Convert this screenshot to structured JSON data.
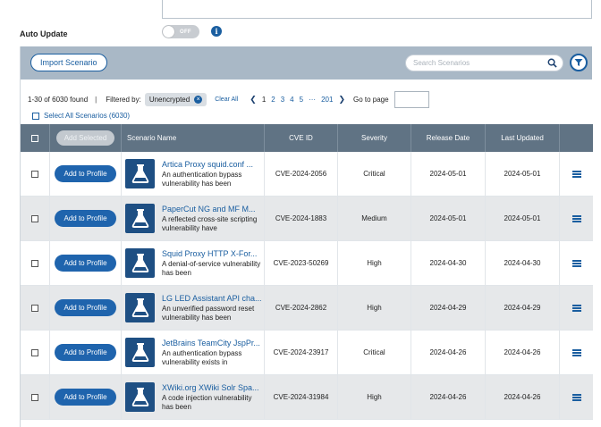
{
  "auto_update": {
    "label": "Auto Update",
    "toggle_text": "OFF",
    "info_glyph": "i"
  },
  "toolbar": {
    "import_label": "Import Scenario",
    "search_placeholder": "Search Scenarios"
  },
  "results": {
    "found_text": "1-30 of 6030 found",
    "separator": "|",
    "filtered_by": "Filtered by:",
    "filter_chip": "Unencrypted",
    "clear_all": "Clear All",
    "pages": [
      "1",
      "2",
      "3",
      "4",
      "5",
      "···",
      "201"
    ],
    "current_page": "1",
    "go_to_page": "Go to page",
    "select_all": "Select All Scenarios (6030)"
  },
  "table": {
    "add_selected": "Add Selected",
    "columns": [
      "Scenario Name",
      "CVE ID",
      "Severity",
      "Release Date",
      "Last Updated"
    ],
    "add_label": "Add to Profile",
    "rows": [
      {
        "title": "Artica Proxy squid.conf ...",
        "desc": "An authentication bypass vulnerability has been",
        "cve": "CVE-2024-2056",
        "severity": "Critical",
        "release": "2024-05-01",
        "updated": "2024-05-01"
      },
      {
        "title": "PaperCut NG and MF M...",
        "desc": "A reflected cross-site scripting vulnerability have",
        "cve": "CVE-2024-1883",
        "severity": "Medium",
        "release": "2024-05-01",
        "updated": "2024-05-01"
      },
      {
        "title": "Squid Proxy HTTP X-For...",
        "desc": "A denial-of-service vulnerability has been",
        "cve": "CVE-2023-50269",
        "severity": "High",
        "release": "2024-04-30",
        "updated": "2024-04-30"
      },
      {
        "title": "LG LED Assistant API cha...",
        "desc": "An unverified password reset vulnerability has been",
        "cve": "CVE-2024-2862",
        "severity": "High",
        "release": "2024-04-29",
        "updated": "2024-04-29"
      },
      {
        "title": "JetBrains TeamCity JspPr...",
        "desc": "An authentication bypass vulnerability exists in",
        "cve": "CVE-2024-23917",
        "severity": "Critical",
        "release": "2024-04-26",
        "updated": "2024-04-26"
      },
      {
        "title": "XWiki.org XWiki Solr Spa...",
        "desc": "A code injection vulnerability has been",
        "cve": "CVE-2024-31984",
        "severity": "High",
        "release": "2024-04-26",
        "updated": "2024-04-26"
      }
    ]
  },
  "colors": {
    "accent": "#1f64ad",
    "toolbar": "#a9b8c6",
    "header": "#607384",
    "alt_row": "#e6e8ea"
  }
}
